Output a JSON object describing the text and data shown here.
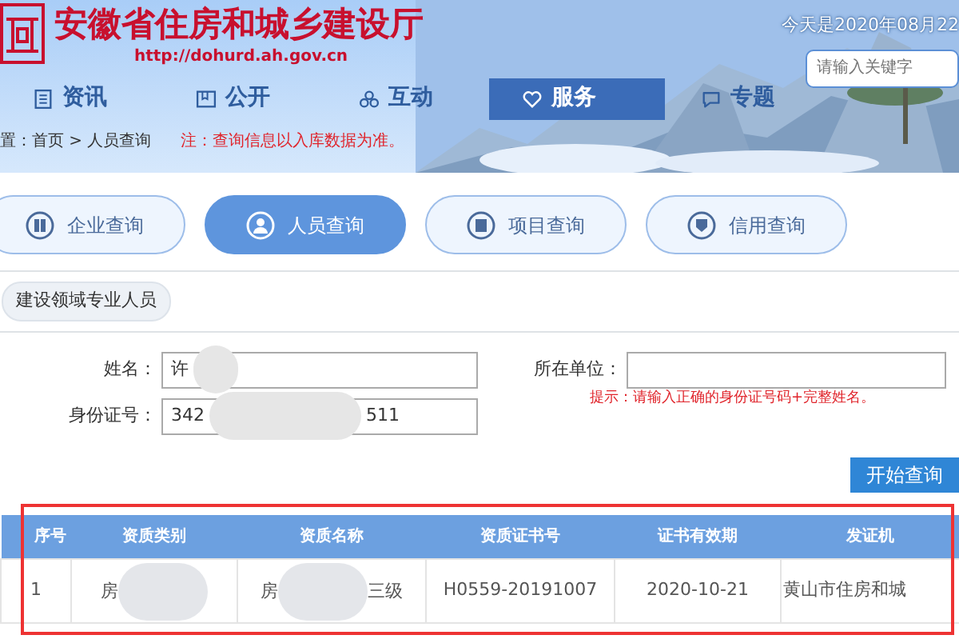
{
  "header": {
    "site_title": "安徽省住房和城乡建设厅",
    "site_url": "http://dohurd.ah.gov.cn",
    "date": "今天是2020年08月22",
    "search": {
      "placeholder": "请输入关键字"
    }
  },
  "nav": [
    {
      "label": "资讯",
      "selected": false
    },
    {
      "label": "公开",
      "selected": false
    },
    {
      "label": "互动",
      "selected": false
    },
    {
      "label": "服务",
      "selected": true
    },
    {
      "label": "专题",
      "selected": false
    }
  ],
  "breadcrumb": "置：首页 > 人员查询",
  "notice": "注：查询信息以入库数据为准。",
  "query_tabs": [
    {
      "label": "企业查询",
      "selected": false
    },
    {
      "label": "人员查询",
      "selected": true
    },
    {
      "label": "项目查询",
      "selected": false
    },
    {
      "label": "信用查询",
      "selected": false
    }
  ],
  "category": "建设领域专业人员",
  "form": {
    "name": {
      "label": "姓名：",
      "value": "许"
    },
    "unit": {
      "label": "所在单位："
    },
    "id_number": {
      "label": "身份证号：",
      "value_start": "342",
      "value_end": "511"
    },
    "hint": "提示：请输入正确的身份证号码+完整姓名。",
    "submit": "开始查询"
  },
  "table": {
    "columns": [
      "序号",
      "资质类别",
      "资质名称",
      "资质证书号",
      "证书有效期",
      "发证机"
    ],
    "rows": [
      {
        "number": "1",
        "category": "房",
        "qualification": "房",
        "qualification_end": "三级",
        "certificate_no": "H0559-20191007",
        "valid_until": "2020-10-21",
        "issuer": "黄山市住房和城"
      }
    ]
  },
  "highlight_frame": true
}
